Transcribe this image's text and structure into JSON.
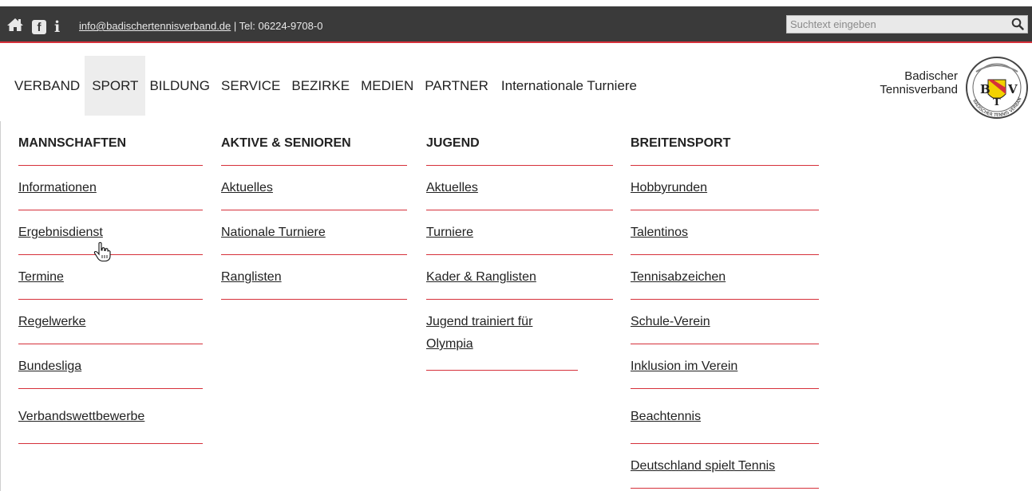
{
  "topbar": {
    "icons": [
      "home-icon",
      "facebook-icon",
      "info-icon"
    ],
    "facebook_glyph": "f",
    "info_glyph": "i",
    "email": "info@badischertennisverband.de",
    "separator": " | ",
    "phone": "Tel: 06224-9708-0",
    "search_placeholder": "Suchtext eingeben",
    "accent": "#d6303a",
    "background": "#3a3a3a"
  },
  "nav": {
    "items": [
      "VERBAND",
      "SPORT",
      "BILDUNG",
      "SERVICE",
      "BEZIRKE",
      "MEDIEN",
      "PARTNER",
      "Internationale Turniere"
    ],
    "active": "SPORT"
  },
  "logo": {
    "line1": "Badischer",
    "line2": "Tennisverband",
    "seal_letters": [
      "B",
      "T",
      "V"
    ],
    "seal_ring_text": "BADISCHER TENNIS VERBAND"
  },
  "dropdown": {
    "columns": [
      {
        "heading": "MANNSCHAFTEN",
        "links": [
          "Informationen",
          "Ergebnisdienst",
          "Termine",
          "Regelwerke",
          "Bundesliga",
          "Verbandswettbewerbe"
        ]
      },
      {
        "heading": "AKTIVE & SENIOREN",
        "links": [
          "Aktuelles",
          "Nationale Turniere",
          "Ranglisten"
        ]
      },
      {
        "heading": "JUGEND",
        "links": [
          "Aktuelles",
          "Turniere",
          "Kader & Ranglisten",
          "Jugend trainiert für Olympia"
        ]
      },
      {
        "heading": "BREITENSPORT",
        "links": [
          "Hobbyrunden",
          "Talentinos",
          "Tennisabzeichen",
          "Schule-Verein",
          "Inklusion im Verein",
          "Beachtennis",
          "Deutschland spielt Tennis"
        ]
      }
    ]
  }
}
